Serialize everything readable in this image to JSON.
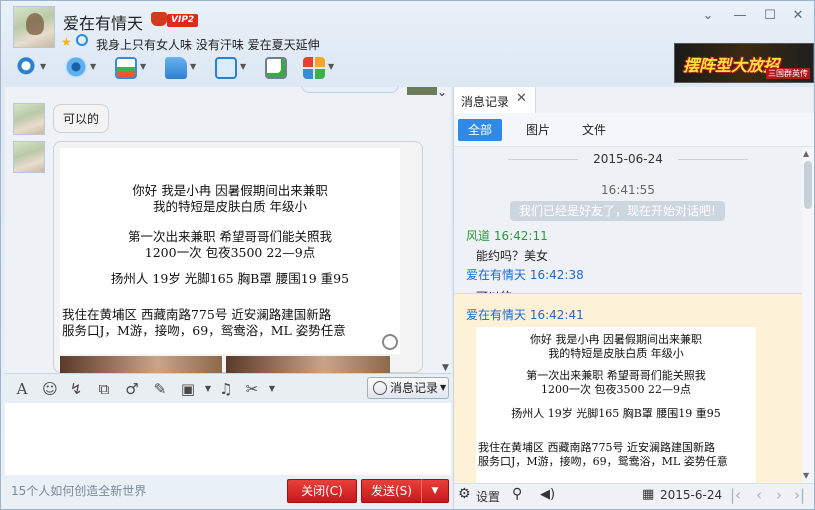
{
  "header": {
    "nickname": "爱在有情天",
    "vip_badge": "VIP2",
    "signature": "我身上只有女人味  没有汗味  爱在夏天延伸",
    "minimize_icon": "chevron-down",
    "ad_banner": {
      "text": "摆阵型大放招",
      "sub": "三国群英传"
    }
  },
  "toolbar": {
    "items": [
      "mic-icon",
      "video-icon",
      "remote-desktop-icon",
      "file-transfer-icon",
      "screen-share-icon",
      "add-app-icon",
      "apps-grid-icon"
    ]
  },
  "chat": {
    "bubble_text": "可以的",
    "ad_lines": [
      "你好  我是小冉  因暑假期间出来兼职",
      "我的特短是皮肤白质  年级小",
      "第一次出来兼职  希望哥哥们能关照我",
      "1200一次   包夜3500   22—9点",
      "扬州人  19岁  光脚165  胸B罩  腰围19  重95",
      "我住在黄埔区  西藏南路775号  近安澜路建国新路",
      "服务口J，M游，接吻，69，鸳鸯浴，ML   姿势任意"
    ]
  },
  "input": {
    "toolbar_icons": [
      "font-icon",
      "emoji-icon",
      "shake-icon",
      "screenshot-icon",
      "voice-icon",
      "edit-icon",
      "image-icon",
      "music-icon",
      "scissors-icon"
    ],
    "history_button_label": "消息记录",
    "hint": "15个人如何创造全新世界",
    "close_label": "关闭(C)",
    "send_label": "发送(S)"
  },
  "history": {
    "tab_label": "消息记录",
    "filters": [
      "全部",
      "图片",
      "文件"
    ],
    "date": "2015-06-24",
    "system_time": "16:41:55",
    "system_msg": "我们已经是好友了，现在开始对话吧!",
    "messages": [
      {
        "sender": "风道",
        "time": "16:42:11",
        "text": "能约吗？美女"
      },
      {
        "sender": "爱在有情天",
        "time": "16:42:38",
        "text": "可以的"
      },
      {
        "sender": "爱在有情天",
        "time": "16:42:41",
        "text": ""
      }
    ],
    "footer": {
      "settings_label": "设置",
      "date": "2015-6-24"
    }
  }
}
